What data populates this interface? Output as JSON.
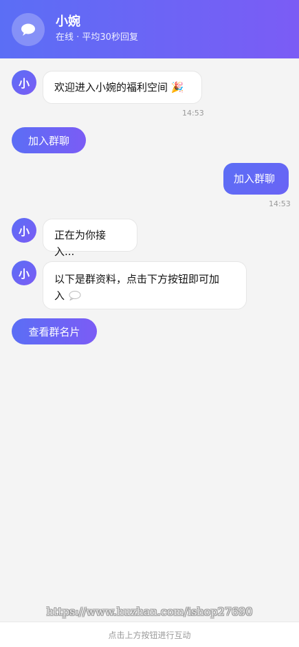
{
  "header": {
    "title": "小婉",
    "status": "在线 · 平均30秒回复",
    "avatar_icon": "chat-bubble-icon"
  },
  "messages": [
    {
      "avatar_text": "小",
      "text": "欢迎进入小婉的福利空间 🎉",
      "time": "14:53"
    },
    {
      "button_label": "加入群聊"
    },
    {
      "self_text": "加入群聊",
      "time": "14:53"
    },
    {
      "avatar_text": "小",
      "text": "正在为你接入..."
    },
    {
      "avatar_text": "小",
      "text_line1": "以下是群资料，点击下方按钮即可加",
      "text_line2": "入"
    },
    {
      "button_label": "查看群名片"
    }
  ],
  "watermark": "https://www.huzhan.com/ishop27690",
  "footer": {
    "hint": "点击上方按钮进行互动"
  },
  "colors": {
    "accent_start": "#5b6ef5",
    "accent_end": "#7b5cf5",
    "background": "#f4f4f4"
  }
}
